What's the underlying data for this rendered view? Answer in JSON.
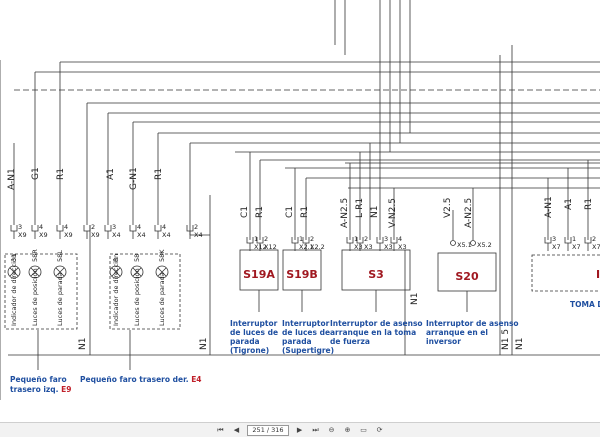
{
  "wire_labels_left": [
    {
      "id": "an1a",
      "text": "A-N1"
    },
    {
      "id": "g1",
      "text": "G1"
    },
    {
      "id": "r1a",
      "text": "R1"
    },
    {
      "id": "a1a",
      "text": "A1"
    },
    {
      "id": "gn1",
      "text": "G-N1"
    },
    {
      "id": "r1b",
      "text": "R1"
    }
  ],
  "wire_labels_mid": [
    {
      "id": "c1a",
      "text": "C1"
    },
    {
      "id": "r1c",
      "text": "R1"
    },
    {
      "id": "c1b",
      "text": "C1"
    },
    {
      "id": "r1d",
      "text": "R1"
    },
    {
      "id": "an25",
      "text": "A-N2.5"
    },
    {
      "id": "lr1",
      "text": "L-R1"
    },
    {
      "id": "n1w",
      "text": "N1"
    },
    {
      "id": "vn25",
      "text": "V-N2.5"
    },
    {
      "id": "v25",
      "text": "V2.5"
    },
    {
      "id": "an25b",
      "text": "A-N2.5"
    },
    {
      "id": "an1b",
      "text": "A-N1"
    },
    {
      "id": "a1b",
      "text": "A1"
    },
    {
      "id": "r1e",
      "text": "R1"
    }
  ],
  "connector_pins": {
    "e9": [
      "3",
      "4",
      "4",
      "2"
    ],
    "e9_x": [
      "X9",
      "X9",
      "X9",
      "X9"
    ],
    "e4": [
      "3",
      "4",
      "4",
      "2"
    ],
    "e4_x": [
      "X4",
      "X4",
      "X4",
      "X4"
    ],
    "s19a": [
      "1",
      "2"
    ],
    "s19a_x": [
      "X12",
      "X12"
    ],
    "s19b": [
      "1",
      "2"
    ],
    "s19b_x": [
      "X2.1",
      "X2.2"
    ],
    "s3": [
      "1",
      "2",
      "3",
      "4"
    ],
    "s3_x": [
      "X3",
      "X3",
      "X3",
      "X3"
    ],
    "s20_x": [
      "X5.1",
      "X5.2"
    ],
    "toma": [
      "3",
      "1",
      "2"
    ],
    "toma_x": [
      "X7",
      "X7",
      "X7"
    ]
  },
  "lamp_box_e9": {
    "pins": [
      "31",
      "58R",
      "58L"
    ],
    "labels": [
      "Indicador de dirección",
      "Luces de posición",
      "Luces de parada"
    ]
  },
  "lamp_box_e4": {
    "pins": [
      "R",
      "58",
      "58K"
    ],
    "labels": [
      "Indicador de dirección",
      "Luces de posición",
      "Luces de parada"
    ]
  },
  "components": {
    "s19a": "S19A",
    "s19b": "S19B",
    "s3": "S3",
    "s20": "S20",
    "toma_tag": "I"
  },
  "descriptions": {
    "s19a": [
      "Interruptor",
      "de luces de",
      "parada",
      "(Tigrone)"
    ],
    "s19b": [
      "Interruptor",
      "de luces de",
      "parada",
      "(Supertigre)"
    ],
    "s3": [
      "Interruptor de asenso",
      "arranque en la toma",
      "de fuerza"
    ],
    "s20": [
      "Interruptor de asenso",
      "arranque en el",
      "inversor"
    ],
    "toma": "TOMA D"
  },
  "ground_labels": {
    "n1a": "N1",
    "n1b": "N1",
    "n1c": "N1",
    "n1d": "N1",
    "n15": "N1 5",
    "n1e": "N1"
  },
  "lamp_captions": {
    "e9_line1": "Pequeño faro",
    "e9_line2": "trasero izq.",
    "e9_code": "E9",
    "e4_text": "Pequeño faro trasero der.",
    "e4_code": "E4"
  },
  "viewer": {
    "page_indicator": "251 / 316"
  }
}
